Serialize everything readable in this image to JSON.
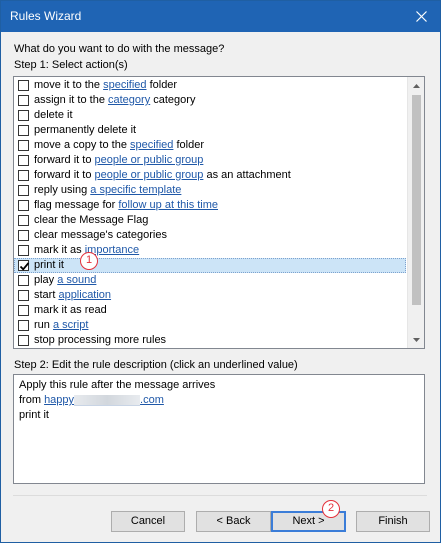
{
  "window": {
    "title": "Rules Wizard"
  },
  "prompt": "What do you want to do with the message?",
  "step1_label": "Step 1: Select action(s)",
  "actions": [
    {
      "checked": false,
      "parts": [
        {
          "t": "move it to the "
        },
        {
          "t": "specified",
          "link": true
        },
        {
          "t": " folder"
        }
      ]
    },
    {
      "checked": false,
      "parts": [
        {
          "t": "assign it to the "
        },
        {
          "t": "category",
          "link": true
        },
        {
          "t": " category"
        }
      ]
    },
    {
      "checked": false,
      "parts": [
        {
          "t": "delete it"
        }
      ]
    },
    {
      "checked": false,
      "parts": [
        {
          "t": "permanently delete it"
        }
      ]
    },
    {
      "checked": false,
      "parts": [
        {
          "t": "move a copy to the "
        },
        {
          "t": "specified",
          "link": true
        },
        {
          "t": " folder"
        }
      ]
    },
    {
      "checked": false,
      "parts": [
        {
          "t": "forward it to "
        },
        {
          "t": "people or public group",
          "link": true
        }
      ]
    },
    {
      "checked": false,
      "parts": [
        {
          "t": "forward it to "
        },
        {
          "t": "people or public group",
          "link": true
        },
        {
          "t": " as an attachment"
        }
      ]
    },
    {
      "checked": false,
      "parts": [
        {
          "t": "reply using "
        },
        {
          "t": "a specific template",
          "link": true
        }
      ]
    },
    {
      "checked": false,
      "parts": [
        {
          "t": "flag message for "
        },
        {
          "t": "follow up at this time",
          "link": true
        }
      ]
    },
    {
      "checked": false,
      "parts": [
        {
          "t": "clear the Message Flag"
        }
      ]
    },
    {
      "checked": false,
      "parts": [
        {
          "t": "clear message's categories"
        }
      ]
    },
    {
      "checked": false,
      "parts": [
        {
          "t": "mark it as "
        },
        {
          "t": "importance",
          "link": true
        }
      ]
    },
    {
      "checked": true,
      "selected": true,
      "parts": [
        {
          "t": "print it"
        }
      ]
    },
    {
      "checked": false,
      "parts": [
        {
          "t": "play "
        },
        {
          "t": "a sound",
          "link": true
        }
      ]
    },
    {
      "checked": false,
      "parts": [
        {
          "t": "start "
        },
        {
          "t": "application",
          "link": true
        }
      ]
    },
    {
      "checked": false,
      "parts": [
        {
          "t": "mark it as read"
        }
      ]
    },
    {
      "checked": false,
      "parts": [
        {
          "t": "run "
        },
        {
          "t": "a script",
          "link": true
        }
      ]
    },
    {
      "checked": false,
      "parts": [
        {
          "t": "stop processing more rules"
        }
      ]
    }
  ],
  "step2_label": "Step 2: Edit the rule description (click an underlined value)",
  "description": {
    "line1": "Apply this rule after the message arrives",
    "from_prefix": "from ",
    "from_link_start": "happy",
    "from_link_end": ".com",
    "line3": "print it"
  },
  "badges": {
    "one": "1",
    "two": "2"
  },
  "buttons": {
    "cancel": "Cancel",
    "back": "< Back",
    "next": "Next >",
    "finish": "Finish"
  },
  "colors": {
    "titlebar": "#1f64b4",
    "link": "#1f58a8",
    "selection": "#cce4f7",
    "badge": "#e5303a",
    "default_button_border": "#3b7dd8"
  }
}
